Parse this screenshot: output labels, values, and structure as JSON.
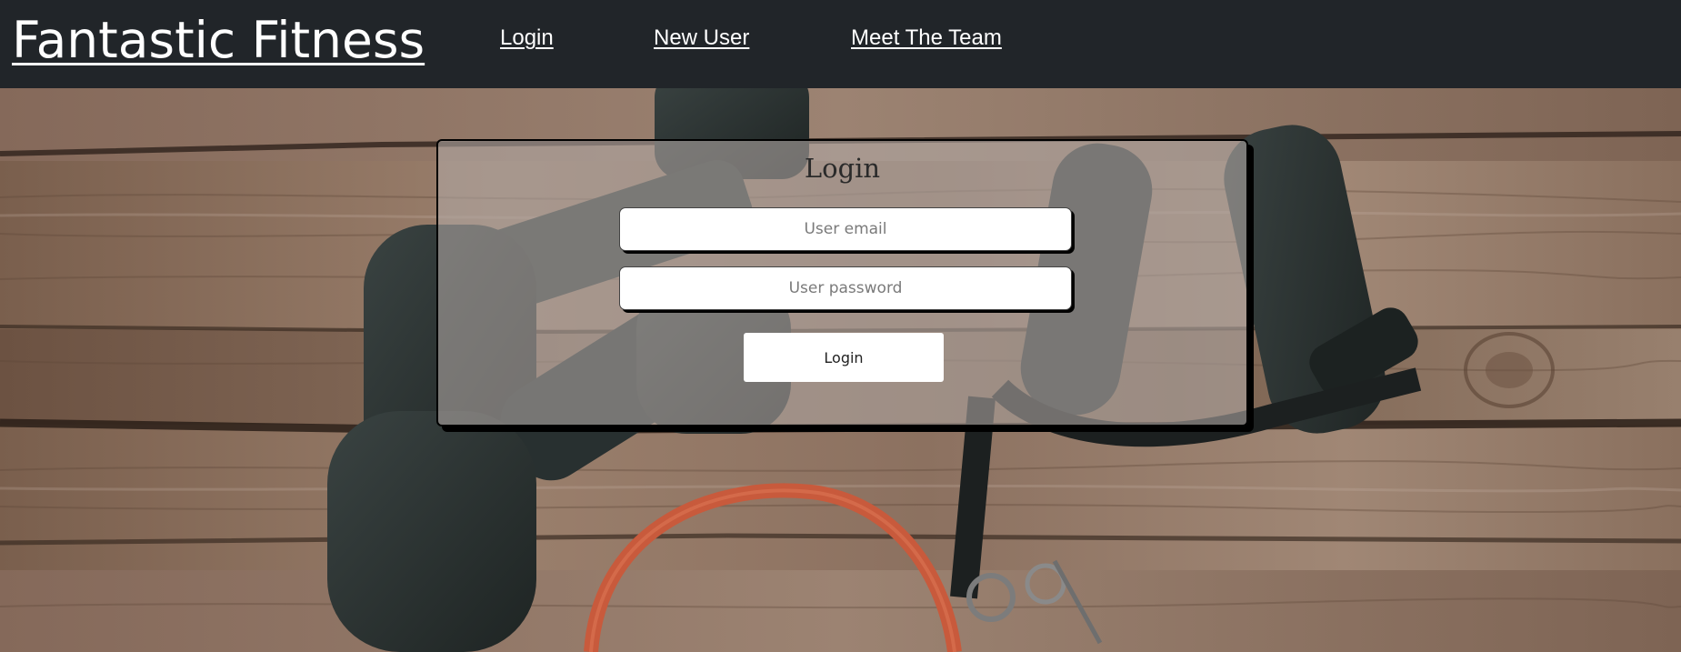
{
  "header": {
    "brand": "Fantastic Fitness",
    "nav": [
      {
        "label": "Login"
      },
      {
        "label": "New User"
      },
      {
        "label": "Meet The Team"
      }
    ]
  },
  "login_card": {
    "title": "Login",
    "email_placeholder": "User email",
    "password_placeholder": "User password",
    "button_label": "Login"
  },
  "colors": {
    "header_bg": "#212529",
    "header_text": "#ffffff",
    "card_overlay": "#b2a8a6",
    "button_bg": "#ffffff",
    "wood": "#8a6f5c",
    "dumbbell": "#2b3231",
    "band": "#c85a3c"
  },
  "background": {
    "icons": [
      "dumbbell-icon",
      "dumbbell-icon",
      "resistance-band-icon",
      "jump-rope-handle-icon"
    ]
  }
}
